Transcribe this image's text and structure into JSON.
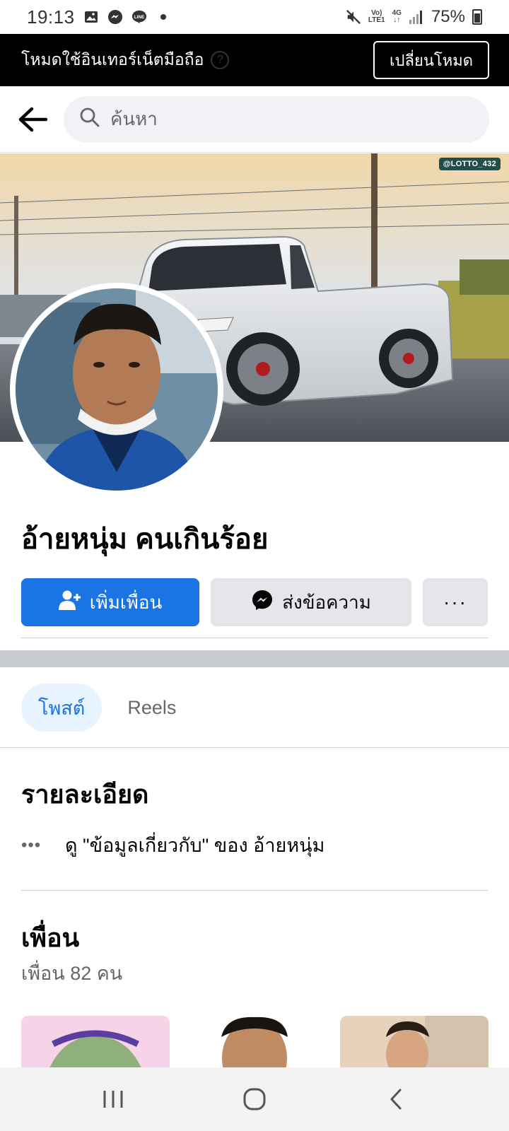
{
  "status_bar": {
    "time": "19:13",
    "volte": "Vo)",
    "lte": "LTE1",
    "network": "4G",
    "battery": "75%"
  },
  "banner": {
    "text": "โหมดใช้อินเทอร์เน็ตมือถือ",
    "button": "เปลี่ยนโหมด"
  },
  "search": {
    "placeholder": "ค้นหา"
  },
  "cover": {
    "watermark": "@LOTTO_432"
  },
  "profile": {
    "name": "อ้ายหนุ่ม คนเกินร้อย"
  },
  "actions": {
    "add_friend": "เพิ่มเพื่อน",
    "message": "ส่งข้อความ",
    "more": "···"
  },
  "tabs": [
    {
      "label": "โพสต์",
      "active": true
    },
    {
      "label": "Reels",
      "active": false
    }
  ],
  "details": {
    "title": "รายละเอียด",
    "about_link": "ดู \"ข้อมูลเกี่ยวกับ\" ของ อ้ายหนุ่ม"
  },
  "friends": {
    "title": "เพื่อน",
    "count": "เพื่อน 82 คน"
  },
  "colors": {
    "brand_blue": "#1b74e4",
    "tab_active_bg": "#e7f3ff",
    "secondary_button": "#e4e6eb"
  }
}
